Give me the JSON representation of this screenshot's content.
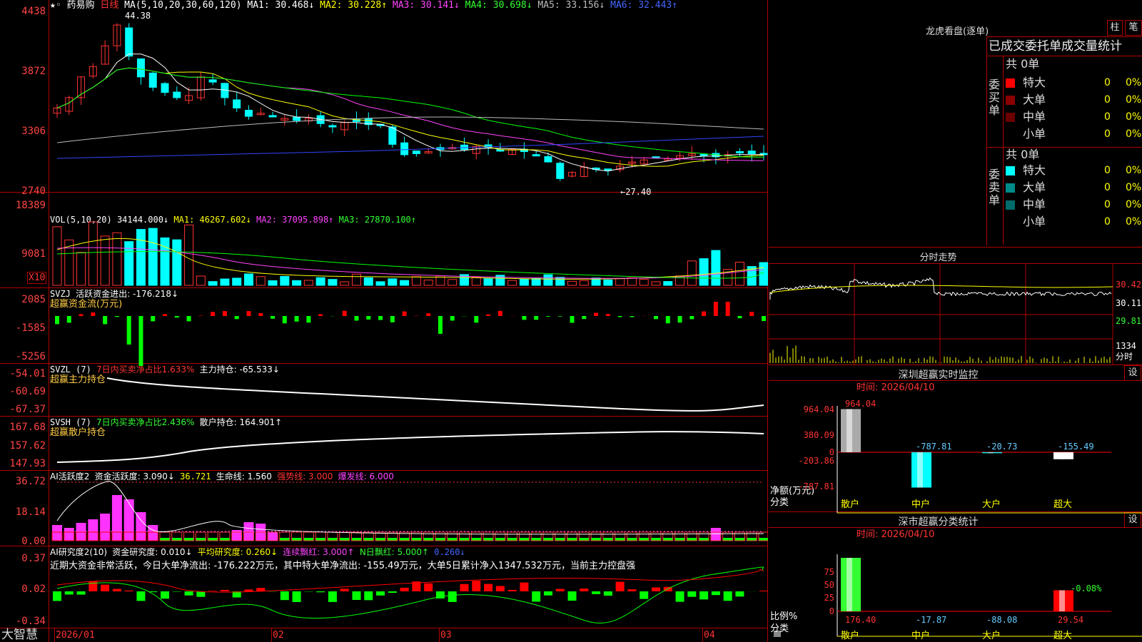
{
  "kline": {
    "stock_name": "药易购",
    "period": "日线",
    "ma_title": "MA(5,10,20,30,60,120)",
    "ma1": "MA1: 30.468↓",
    "ma2": "MA2: 30.228↑",
    "ma3": "MA3: 30.141↓",
    "ma4": "MA4: 30.698↓",
    "ma5": "MA5: 33.156↓",
    "ma6": "MA6: 32.443↑",
    "high_mark": "44.38",
    "low_mark": "←27.40",
    "y_labels": [
      "4438",
      "3872",
      "3306",
      "2740"
    ]
  },
  "vol": {
    "title": "VOL(5,10,20)",
    "value": "34144.000↓",
    "ma1": "MA1: 46267.602↓",
    "ma2": "MA2: 37095.898↑",
    "ma3": "MA3: 27870.100↑",
    "y_labels": [
      "18389",
      "9081"
    ],
    "unit": "X10"
  },
  "svzj": {
    "title": "SVZJ",
    "label": "活跃资金进出: -176.218↓",
    "subtitle": "超赢资金流(万元)",
    "y_labels": [
      "2085",
      "-1585",
      "-5256"
    ]
  },
  "svzl": {
    "title": "SVZL (7)",
    "ratio": "7日内买卖净占比1.633%",
    "hold": "主力持仓: -65.533↓",
    "subtitle": "超赢主力持仓",
    "y_labels": [
      "-54.01",
      "-60.69",
      "-67.37"
    ]
  },
  "svsh": {
    "title": "SVSH (7)",
    "ratio": "7日内买卖净占比2.436%",
    "hold": "散户持仓: 164.901↑",
    "subtitle": "超赢散户持仓",
    "y_labels": [
      "167.68",
      "157.62",
      "147.93"
    ]
  },
  "ai_act": {
    "title": "AI活跃度2",
    "v1": "资金活跃度: 3.090↓",
    "v2": "36.721",
    "v3": "生命线: 1.560",
    "v4": "强势线: 3.000",
    "v5": "爆发线: 6.000",
    "y_labels": [
      "36.72",
      "18.14",
      "0.00"
    ]
  },
  "ai_res": {
    "title": "AI研究度2(10)",
    "v1": "资金研究度: 0.010↓",
    "v2": "平均研究度: 0.260↓",
    "v3": "连续飘红: 3.000↑",
    "v4": "N日飘红: 5.000↑",
    "v5": "0.260↓",
    "text": "近期大资金非常活跃，今日大单净流出: -176.222万元，其中特大单净流出: -155.49万元，大单5日累计净入1347.532万元，当前主力控盘强",
    "y_labels": [
      "0.37",
      "0.02",
      "-0.34"
    ]
  },
  "bottom": {
    "brand": "大智慧",
    "dates": [
      "2026/01",
      "02",
      "03",
      "04"
    ]
  },
  "lhb": {
    "title": "龙虎看盘(逐单)",
    "btn_zhu": "柱",
    "btn_bi": "笔",
    "table_title": "已成交委托单成交量统计",
    "buy_label": "委买单",
    "sell_label": "委卖单",
    "buy_total": "共 0单",
    "sell_total": "共 0单",
    "buy_rows": [
      {
        "name": "特大",
        "count": "0",
        "pct": "0%",
        "color": "#ff0000"
      },
      {
        "name": "大单",
        "count": "0",
        "pct": "0%",
        "color": "#8b0000"
      },
      {
        "name": "中单",
        "count": "0",
        "pct": "0%",
        "color": "#6b0000"
      },
      {
        "name": "小单",
        "count": "0",
        "pct": "0%",
        "color": "#000000"
      }
    ],
    "sell_rows": [
      {
        "name": "特大",
        "count": "0",
        "pct": "0%",
        "color": "#00ffff"
      },
      {
        "name": "大单",
        "count": "0",
        "pct": "0%",
        "color": "#008b8b"
      },
      {
        "name": "中单",
        "count": "0",
        "pct": "0%",
        "color": "#006b6b"
      },
      {
        "name": "小单",
        "count": "0",
        "pct": "0%",
        "color": "#000000"
      }
    ]
  },
  "fenshi": {
    "title": "分时走势",
    "y_labels": [
      "30.42",
      "30.11",
      "29.81"
    ],
    "vol_label": "1334",
    "vol_unit": "分时"
  },
  "sz_monitor": {
    "title": "深圳超赢实时监控",
    "btn": "设",
    "time": "时间: 2026/04/10",
    "y_labels": [
      "964.04",
      "380.09",
      "0",
      "-203.86",
      "-787.81"
    ],
    "y_unit": "净额(万元)",
    "x_unit": "分类",
    "chart_data": {
      "type": "bar",
      "categories": [
        "散户",
        "中户",
        "大户",
        "超大"
      ],
      "values": [
        964.04,
        -787.81,
        -20.73,
        -155.49
      ],
      "value_labels": [
        "964.04",
        "-787.81",
        "-20.73",
        "-155.49"
      ],
      "ylim": [
        -787.81,
        964.04
      ]
    }
  },
  "sz_class": {
    "title": "深市超赢分类统计",
    "btn": "设",
    "time": "时间: 2026/04/10",
    "y_labels": [
      "75",
      "50",
      "25",
      "0"
    ],
    "y_unit": "比例%",
    "x_unit": "分类",
    "bar_label": "-0.08%",
    "chart_data": {
      "type": "bar",
      "categories": [
        "散户",
        "中户",
        "大户",
        "超大"
      ],
      "values": [
        176.4,
        -17.87,
        -88.08,
        29.54
      ],
      "value_labels": [
        "176.40",
        "-17.87",
        "-88.08",
        "29.54"
      ],
      "ylim": [
        0,
        75
      ]
    }
  },
  "colors": {
    "grid": "#b00000",
    "up": "#ff3333",
    "down": "#00ffff",
    "green": "#00ff00"
  }
}
